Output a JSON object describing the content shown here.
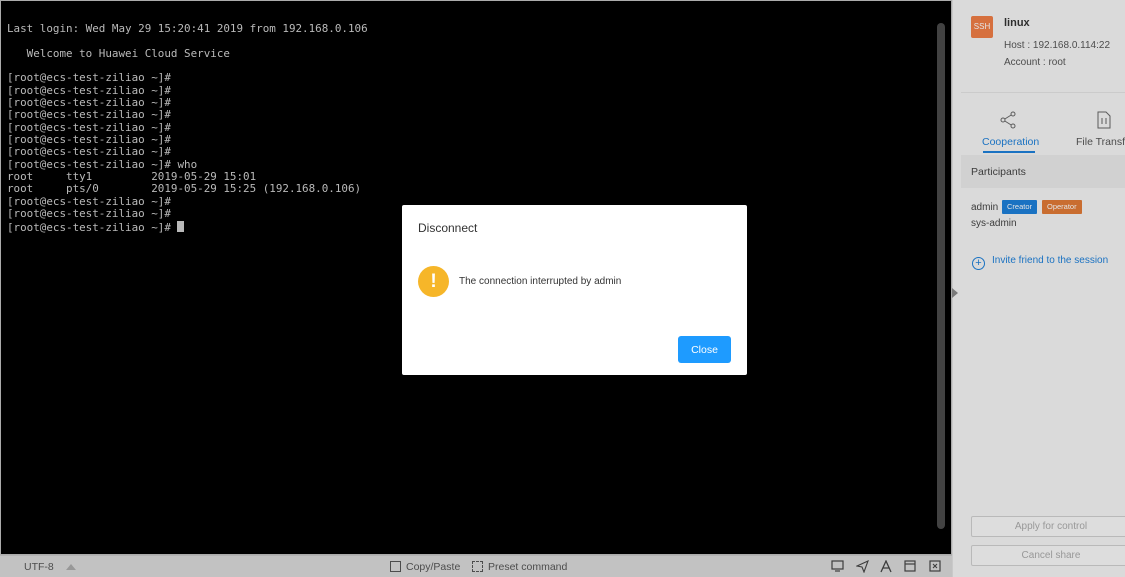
{
  "terminal": {
    "lines": [
      "Last login: Wed May 29 15:20:41 2019 from 192.168.0.106",
      "",
      "   Welcome to Huawei Cloud Service",
      "",
      "[root@ecs-test-ziliao ~]#",
      "[root@ecs-test-ziliao ~]#",
      "[root@ecs-test-ziliao ~]#",
      "[root@ecs-test-ziliao ~]#",
      "[root@ecs-test-ziliao ~]#",
      "[root@ecs-test-ziliao ~]#",
      "[root@ecs-test-ziliao ~]#",
      "[root@ecs-test-ziliao ~]# who",
      "root     tty1         2019-05-29 15:01",
      "root     pts/0        2019-05-29 15:25 (192.168.0.106)",
      "[root@ecs-test-ziliao ~]#",
      "[root@ecs-test-ziliao ~]#",
      "[root@ecs-test-ziliao ~]# "
    ]
  },
  "status_bar": {
    "encoding": "UTF-8",
    "copy_paste": "Copy/Paste",
    "preset_command": "Preset command",
    "tool_icons": [
      "screen-icon",
      "send-icon",
      "font-icon",
      "window-icon",
      "exit-icon"
    ]
  },
  "side_panel": {
    "badge": "SSH",
    "host_name": "linux",
    "host_line": "Host : 192.168.0.114:22",
    "account_line": "Account : root",
    "tabs": [
      "Cooperation",
      "File Transfer"
    ],
    "participants_title": "Participants",
    "participants": [
      {
        "name": "admin",
        "roles": [
          "Creator",
          "Operator"
        ]
      },
      {
        "name": "sys-admin",
        "roles": []
      }
    ],
    "invite": "Invite friend to the session",
    "apply_button": "Apply for control",
    "cancel_button": "Cancel share"
  },
  "modal": {
    "title": "Disconnect",
    "message": "The connection interrupted by admin",
    "close_button": "Close",
    "icon_glyph": "!"
  },
  "colors": {
    "accent": "#1e9bff",
    "warning": "#f6b629",
    "ssh_badge": "#ef7d46",
    "creator_badge": "#1e7fd8",
    "operator_badge": "#e07a36"
  }
}
